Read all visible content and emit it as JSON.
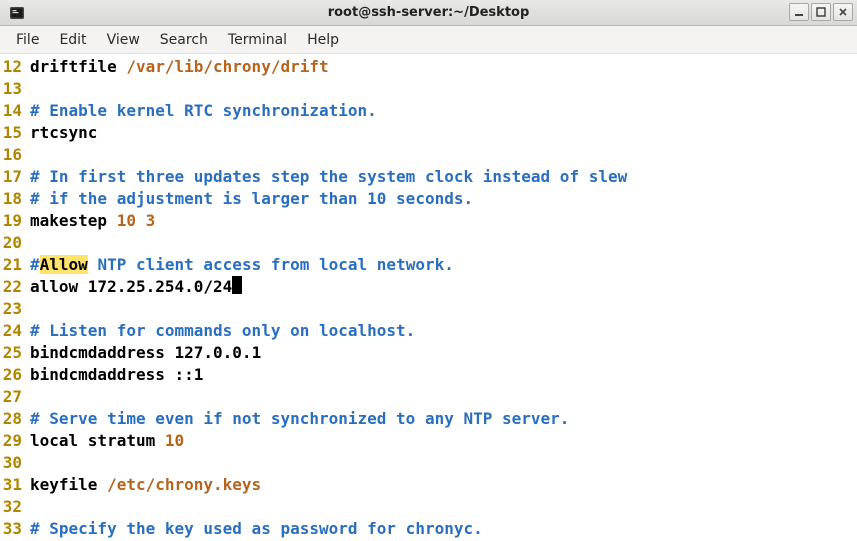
{
  "window": {
    "title": "root@ssh-server:~/Desktop"
  },
  "menubar": {
    "items": [
      "File",
      "Edit",
      "View",
      "Search",
      "Terminal",
      "Help"
    ]
  },
  "editor": {
    "lines": [
      {
        "n": "12",
        "segs": [
          {
            "cls": "c-keyword",
            "t": "driftfile "
          },
          {
            "cls": "c-value",
            "t": "/var/lib/chrony/drift"
          }
        ]
      },
      {
        "n": "13",
        "segs": []
      },
      {
        "n": "14",
        "segs": [
          {
            "cls": "c-comment",
            "t": "# Enable kernel RTC synchronization."
          }
        ]
      },
      {
        "n": "15",
        "segs": [
          {
            "cls": "c-keyword",
            "t": "rtcsync"
          }
        ]
      },
      {
        "n": "16",
        "segs": []
      },
      {
        "n": "17",
        "segs": [
          {
            "cls": "c-comment",
            "t": "# In first three updates step the system clock instead of slew"
          }
        ]
      },
      {
        "n": "18",
        "segs": [
          {
            "cls": "c-comment",
            "t": "# if the adjustment is larger than 10 seconds."
          }
        ]
      },
      {
        "n": "19",
        "segs": [
          {
            "cls": "c-keyword",
            "t": "makestep "
          },
          {
            "cls": "c-value",
            "t": "10 3"
          }
        ]
      },
      {
        "n": "20",
        "segs": []
      },
      {
        "n": "21",
        "segs": [
          {
            "cls": "c-comment",
            "t": "#"
          },
          {
            "cls": "hl-search",
            "t": "Allow"
          },
          {
            "cls": "c-comment",
            "t": " NTP client access from local network."
          }
        ]
      },
      {
        "n": "22",
        "segs": [
          {
            "cls": "c-keyword",
            "t": "allow "
          },
          {
            "cls": "c-ip",
            "t": "172.25.254.0/24"
          },
          {
            "cls": "cursor",
            "t": ""
          }
        ]
      },
      {
        "n": "23",
        "segs": []
      },
      {
        "n": "24",
        "segs": [
          {
            "cls": "c-comment",
            "t": "# Listen for commands only on localhost."
          }
        ]
      },
      {
        "n": "25",
        "segs": [
          {
            "cls": "c-keyword",
            "t": "bindcmdaddress "
          },
          {
            "cls": "c-ip",
            "t": "127.0.0.1"
          }
        ]
      },
      {
        "n": "26",
        "segs": [
          {
            "cls": "c-keyword",
            "t": "bindcmdaddress "
          },
          {
            "cls": "c-ip",
            "t": "::1"
          }
        ]
      },
      {
        "n": "27",
        "segs": []
      },
      {
        "n": "28",
        "segs": [
          {
            "cls": "c-comment",
            "t": "# Serve time even if not synchronized to any NTP server."
          }
        ]
      },
      {
        "n": "29",
        "segs": [
          {
            "cls": "c-keyword",
            "t": "local stratum "
          },
          {
            "cls": "c-value",
            "t": "10"
          }
        ]
      },
      {
        "n": "30",
        "segs": []
      },
      {
        "n": "31",
        "segs": [
          {
            "cls": "c-keyword",
            "t": "keyfile "
          },
          {
            "cls": "c-value",
            "t": "/etc/chrony.keys"
          }
        ]
      },
      {
        "n": "32",
        "segs": []
      },
      {
        "n": "33",
        "segs": [
          {
            "cls": "c-comment",
            "t": "# Specify the key used as password for chronyc."
          }
        ]
      }
    ]
  }
}
